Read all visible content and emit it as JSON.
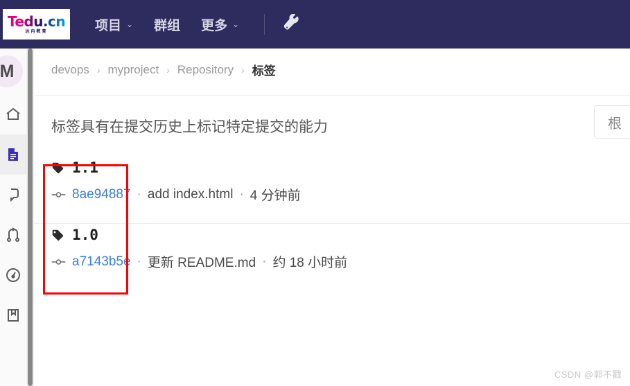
{
  "topbar": {
    "logo": {
      "main": "Tedu.cn",
      "sub": "达内教育",
      "name": "tedu-logo"
    },
    "nav": [
      {
        "label": "项目",
        "caret": "⌄",
        "has_caret": true
      },
      {
        "label": "群组",
        "caret": "",
        "has_caret": false
      },
      {
        "label": "更多",
        "caret": "⌄",
        "has_caret": true
      }
    ],
    "tools_icon": "wrench-icon",
    "background_color": "#2e2c5f"
  },
  "sidebar": {
    "avatar": {
      "initial": "M",
      "color": "#f3e6f5"
    },
    "items": [
      {
        "icon": "home-icon",
        "active": false
      },
      {
        "icon": "repository-file-icon",
        "active": true
      },
      {
        "icon": "issues-icon",
        "active": false
      },
      {
        "icon": "merge-requests-icon",
        "active": false
      },
      {
        "icon": "cicd-gauge-icon",
        "active": false
      },
      {
        "icon": "wiki-book-icon",
        "active": false
      }
    ],
    "active_color": "#3c2fb5"
  },
  "breadcrumb": {
    "separator": "›",
    "items": [
      {
        "label": "devops",
        "current": false
      },
      {
        "label": "myproject",
        "current": false
      },
      {
        "label": "Repository",
        "current": false
      },
      {
        "label": "标签",
        "current": true
      }
    ]
  },
  "main": {
    "description": "标签具有在提交历史上标记特定提交的能力",
    "sort_dropdown": {
      "label": "根",
      "name": "sort-dropdown"
    },
    "tags": [
      {
        "name": "1.1",
        "sha": "8ae94887",
        "message": "add index.html",
        "time": "4 分钟前",
        "separator": "·"
      },
      {
        "name": "1.0",
        "sha": "a7143b5e",
        "message": "更新 README.md",
        "time": "约 18 小时前",
        "separator": "·"
      }
    ]
  },
  "annotation": {
    "color": "#ff0000",
    "name": "red-highlight-box"
  },
  "watermark": {
    "text": "CSDN @郭不戳"
  }
}
